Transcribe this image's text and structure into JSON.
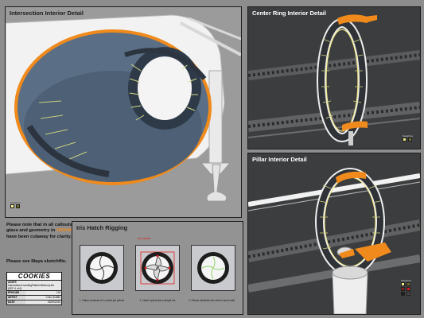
{
  "panels": {
    "intersection": {
      "title": "Intersection Interior Detail",
      "swatch_label": "Swatches"
    },
    "center_ring": {
      "title": "Center Ring Interior Detail",
      "swatch_label": "Swatches"
    },
    "pillar": {
      "title": "Pillar Interior Detail",
      "swatch_label": "Swatches"
    },
    "iris": {
      "title": "Iris Hatch Rigging"
    }
  },
  "notes": {
    "line1": "Please note that in all callouts,",
    "line2a": "glass and geometry in ",
    "highlight": "ORANGE",
    "line3": "have been cutaway for clarity.",
    "sketchfile": "Please see Maya sketchfile."
  },
  "iris": {
    "pivot_label": "pivot points",
    "captions": [
      "1. Hatch consists of 4 curved pie pieces",
      "2. Hatch opens like a simple iris",
      "3. Pieces withdraw into slot in tunnel wall"
    ]
  },
  "title_block": {
    "logo": "COOKIES",
    "asset_label": "ASSET:",
    "asset_value": "haemahaunt.LandingPlatformBalcony.intr (SEP 4 of 6)",
    "rows": [
      {
        "k": "EPISODE",
        "v": "115"
      },
      {
        "k": "ARTIST",
        "v": "Colin Grafflin"
      },
      {
        "k": "DATE",
        "v": "05/29/2020"
      }
    ]
  },
  "colors": {
    "cutaway_orange": "#f08a1c",
    "panel_bg": "#3a3c3e",
    "page_bg": "#8d8d8d",
    "accent_red": "#e01b1b",
    "light_yellow": "#f3e98a"
  }
}
